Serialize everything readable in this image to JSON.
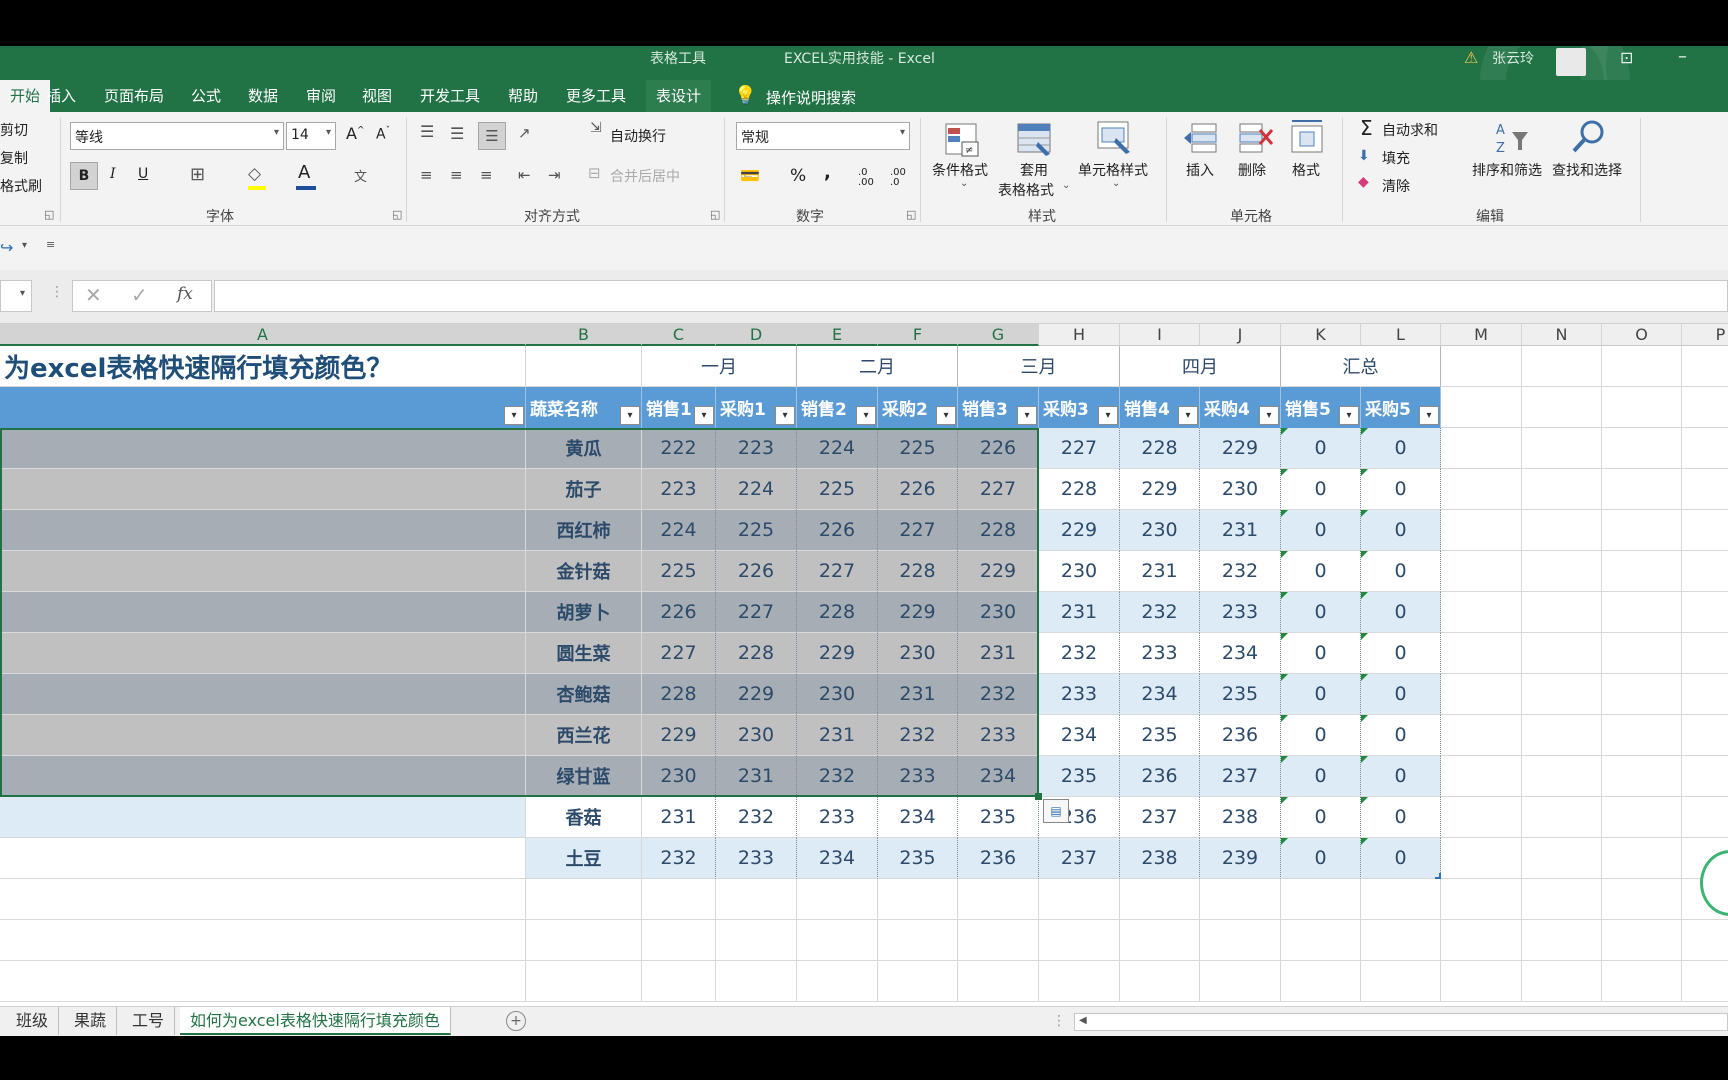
{
  "window": {
    "context_tab_group": "表格工具",
    "title": "EXCEL实用技能 - Excel",
    "user": "张云玲"
  },
  "ribbon_tabs": [
    {
      "label": "开始",
      "active": true
    },
    {
      "label": "插入"
    },
    {
      "label": "页面布局"
    },
    {
      "label": "公式"
    },
    {
      "label": "数据"
    },
    {
      "label": "审阅"
    },
    {
      "label": "视图"
    },
    {
      "label": "开发工具"
    },
    {
      "label": "帮助"
    },
    {
      "label": "更多工具"
    },
    {
      "label": "表设计",
      "contextual": true
    }
  ],
  "tell_me": "操作说明搜索",
  "clipboard": {
    "cut": "剪切",
    "copy": "复制",
    "format_painter": "格式刷"
  },
  "font": {
    "name": "等线",
    "size": "14",
    "group_label": "字体",
    "bold": "B",
    "italic": "I",
    "underline": "U",
    "grow": "A",
    "shrink": "A",
    "color_letter": "A",
    "phonetic": "文"
  },
  "alignment": {
    "wrap_text": "自动换行",
    "merge_center": "合并后居中",
    "group_label": "对齐方式"
  },
  "number": {
    "format": "常规",
    "group_label": "数字",
    "percent": "%",
    "comma": ",",
    "inc_decimal": ".0\n.00",
    "dec_decimal": ".00\n.0"
  },
  "styles": {
    "conditional": "条件格式",
    "table_format_line1": "套用",
    "table_format_line2": "表格格式",
    "cell_styles": "单元格样式",
    "group_label": "样式"
  },
  "cells": {
    "insert": "插入",
    "delete": "删除",
    "format": "格式",
    "group_label": "单元格"
  },
  "editing": {
    "autosum": "自动求和",
    "fill": "填充",
    "clear": "清除",
    "sort_filter": "排序和筛选",
    "find_select": "查找和选择",
    "group_label": "编辑",
    "sigma": "Σ"
  },
  "formula_bar": {
    "fx": "fx",
    "value": ""
  },
  "columns": [
    "A",
    "B",
    "C",
    "D",
    "E",
    "F",
    "G",
    "H",
    "I",
    "J",
    "K",
    "L",
    "M",
    "N",
    "O",
    "P"
  ],
  "sheet": {
    "title": "为excel表格快速隔行填充颜色？",
    "months": [
      "一月",
      "二月",
      "三月",
      "四月",
      "汇总"
    ],
    "header_row": [
      "",
      "蔬菜名称",
      "销售1",
      "采购1",
      "销售2",
      "采购2",
      "销售3",
      "采购3",
      "销售4",
      "采购4",
      "销售5",
      "采购5"
    ],
    "rows": [
      [
        "黄瓜",
        "222",
        "223",
        "224",
        "225",
        "226",
        "227",
        "228",
        "229",
        "0",
        "0"
      ],
      [
        "茄子",
        "223",
        "224",
        "225",
        "226",
        "227",
        "228",
        "229",
        "230",
        "0",
        "0"
      ],
      [
        "西红柿",
        "224",
        "225",
        "226",
        "227",
        "228",
        "229",
        "230",
        "231",
        "0",
        "0"
      ],
      [
        "金针菇",
        "225",
        "226",
        "227",
        "228",
        "229",
        "230",
        "231",
        "232",
        "0",
        "0"
      ],
      [
        "胡萝卜",
        "226",
        "227",
        "228",
        "229",
        "230",
        "231",
        "232",
        "233",
        "0",
        "0"
      ],
      [
        "圆生菜",
        "227",
        "228",
        "229",
        "230",
        "231",
        "232",
        "233",
        "234",
        "0",
        "0"
      ],
      [
        "杏鲍菇",
        "228",
        "229",
        "230",
        "231",
        "232",
        "233",
        "234",
        "235",
        "0",
        "0"
      ],
      [
        "西兰花",
        "229",
        "230",
        "231",
        "232",
        "233",
        "234",
        "235",
        "236",
        "0",
        "0"
      ],
      [
        "绿甘蓝",
        "230",
        "231",
        "232",
        "233",
        "234",
        "235",
        "236",
        "237",
        "0",
        "0"
      ],
      [
        "香菇",
        "231",
        "232",
        "233",
        "234",
        "235",
        "236",
        "237",
        "238",
        "0",
        "0"
      ],
      [
        "土豆",
        "232",
        "233",
        "234",
        "235",
        "236",
        "237",
        "238",
        "239",
        "0",
        "0"
      ]
    ]
  },
  "sheet_tabs": [
    "班级",
    "果蔬",
    "工号",
    "如何为excel表格快速隔行填充颜色"
  ],
  "active_sheet": 3,
  "colors": {
    "excel_green": "#217346",
    "header_blue": "#5b9bd5",
    "band_light": "#ddebf7",
    "selection_gray": "#a6adb4"
  }
}
